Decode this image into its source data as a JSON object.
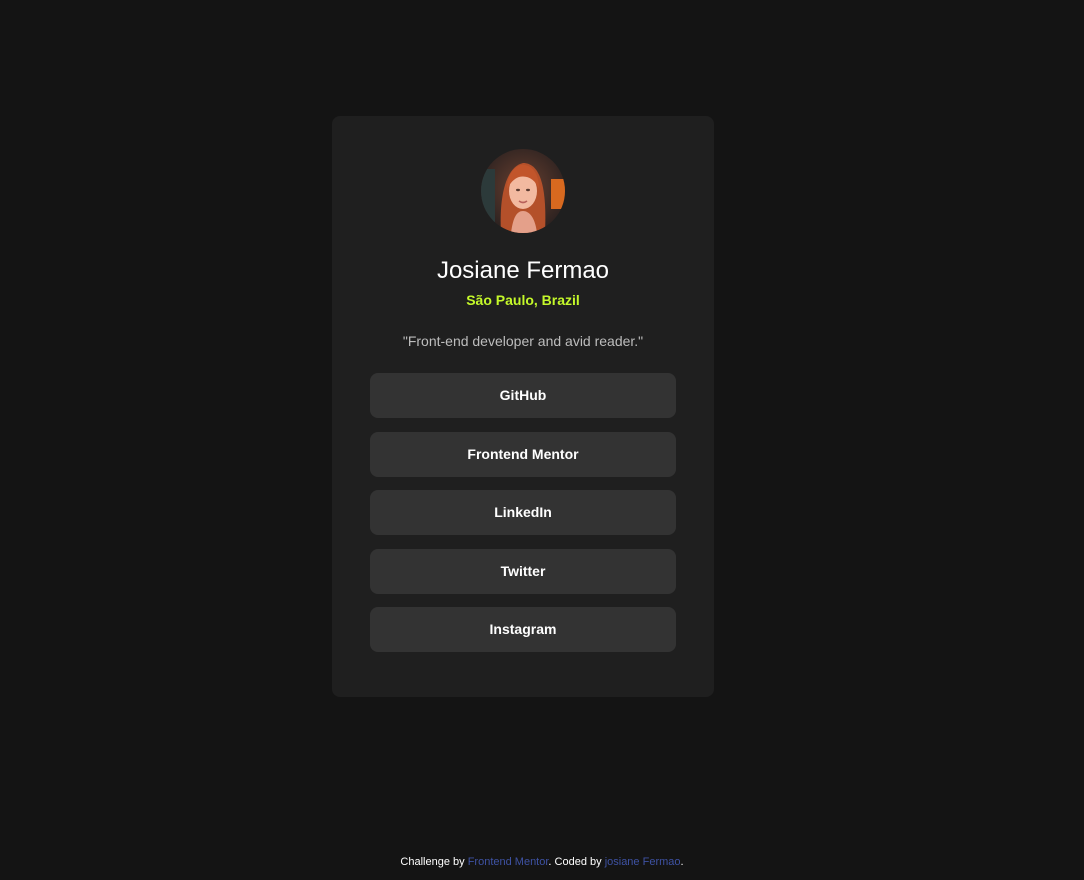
{
  "profile": {
    "name": "Josiane Fermao",
    "location": "São Paulo, Brazil",
    "bio": "\"Front-end developer and avid reader.\""
  },
  "links": [
    {
      "label": "GitHub"
    },
    {
      "label": "Frontend Mentor"
    },
    {
      "label": "LinkedIn"
    },
    {
      "label": "Twitter"
    },
    {
      "label": "Instagram"
    }
  ],
  "footer": {
    "prefix": "Challenge by ",
    "challenge_link": "Frontend Mentor",
    "middle": ". Coded by ",
    "author_link": "josiane Fermao",
    "suffix": "."
  },
  "colors": {
    "background": "#141414",
    "card": "#1f1f1f",
    "button": "#333333",
    "accent": "#c4f82a",
    "footer_link": "#3e52a3"
  }
}
